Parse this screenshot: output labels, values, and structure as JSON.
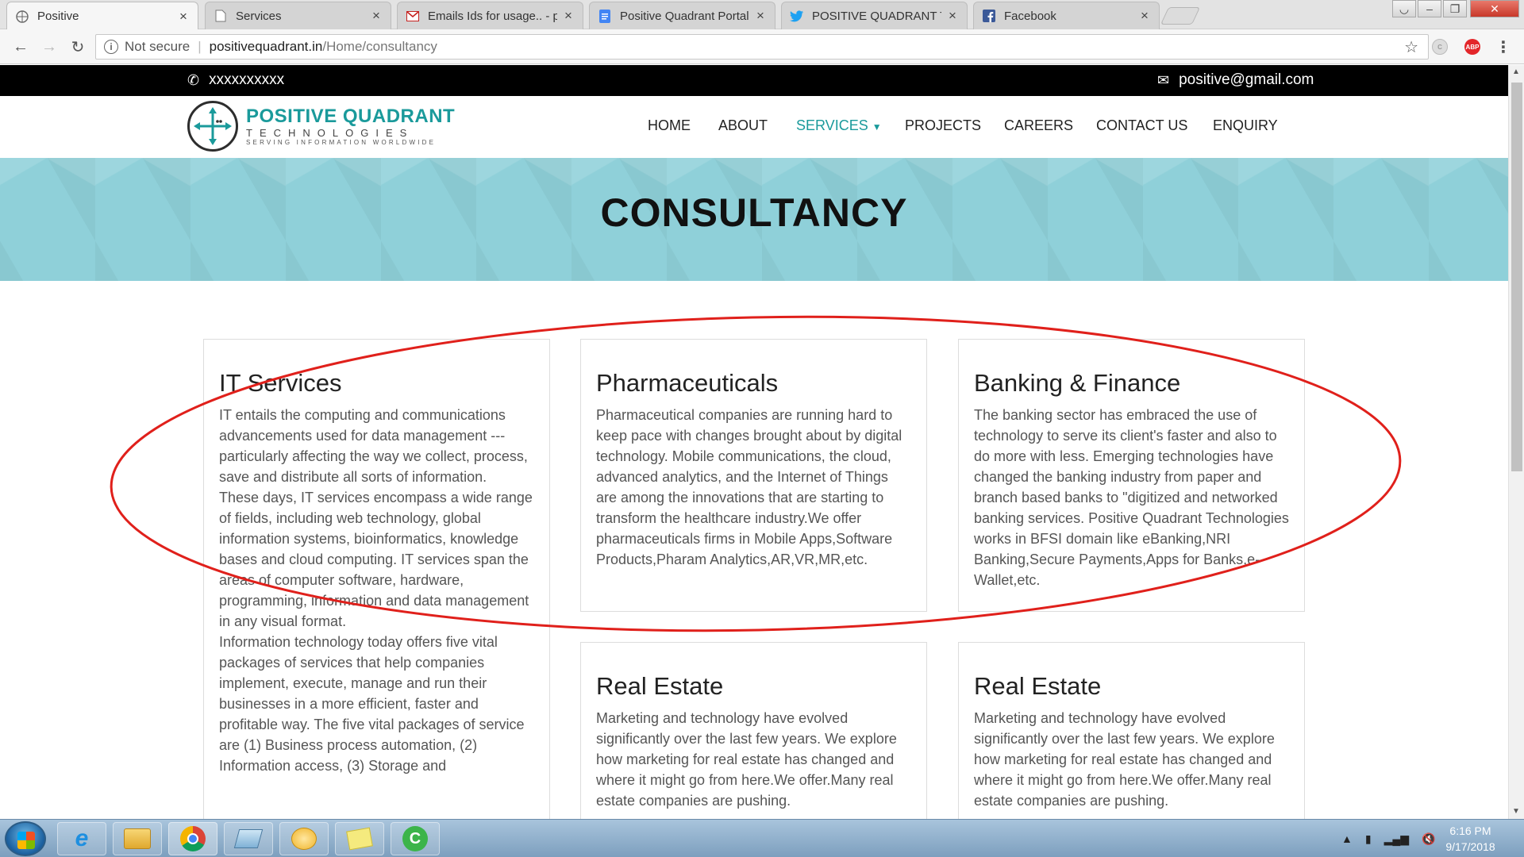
{
  "browser": {
    "tabs": [
      {
        "title": "Positive",
        "icon": "globe-icon",
        "active": true
      },
      {
        "title": "Services",
        "icon": "page-icon",
        "active": false
      },
      {
        "title": "Emails Ids for usage.. - pc",
        "icon": "gmail-icon",
        "active": false
      },
      {
        "title": "Positive Quadrant Portal",
        "icon": "docs-icon",
        "active": false
      },
      {
        "title": "POSITIVE QUADRANT TE",
        "icon": "twitter-icon",
        "active": false
      },
      {
        "title": "Facebook",
        "icon": "facebook-icon",
        "active": false
      }
    ],
    "security": "Not secure",
    "url_host": "positivequadrant.in",
    "url_path": "/Home/consultancy"
  },
  "site": {
    "phone": "xxxxxxxxxx",
    "email": "positive@gmail.com",
    "logo": {
      "brand": "POSITIVE QUADRANT",
      "sub": "TECHNOLOGIES",
      "tagline": "SERVING INFORMATION WORLDWIDE"
    },
    "nav": [
      "HOME",
      "ABOUT",
      "SERVICES",
      "PROJECTS",
      "CAREERS",
      "CONTACT US",
      "ENQUIRY"
    ],
    "active_nav": "SERVICES",
    "banner_title": "CONSULTANCY",
    "cards": [
      {
        "title": "IT Services",
        "body": "IT entails the computing and communications advancements used for data management --- particularly affecting the way we collect, process, save and distribute all sorts of information.\nThese days, IT services encompass a wide range of fields, including web technology, global information systems, bioinformatics, knowledge bases and cloud computing. IT services span the areas of computer software, hardware, programming, information and data management in any visual format.\nInformation technology today offers five vital packages of services that help companies implement, execute, manage and run their businesses in a more efficient, faster and profitable way. The five vital packages of service are (1) Business process automation, (2) Information access, (3) Storage and"
      },
      {
        "title": "Pharmaceuticals",
        "body": "Pharmaceutical companies are running hard to keep pace with changes brought about by digital technology. Mobile communications, the cloud, advanced analytics, and the Internet of Things are among the innovations that are starting to transform the healthcare industry.We offer pharmaceuticals firms in Mobile Apps,Software Products,Pharam Analytics,AR,VR,MR,etc."
      },
      {
        "title": "Banking & Finance",
        "body": "The banking sector has embraced the use of technology to serve its client's faster and also to do more with less. Emerging technologies have changed the banking industry from paper and branch based banks to \"digitized and networked banking services. Positive Quadrant Technologies works in BFSI domain like eBanking,NRI Banking,Secure Payments,Apps for Banks,e-Wallet,etc."
      },
      {
        "title": "Real Estate",
        "body": "Marketing and technology have evolved significantly over the last few years. We explore how marketing for real estate has changed and where it might go from here.We offer.Many real estate companies are pushing."
      },
      {
        "title": "Real Estate",
        "body": "Marketing and technology have evolved significantly over the last few years. We explore how marketing for real estate has changed and where it might go from here.We offer.Many real estate companies are pushing."
      }
    ]
  },
  "taskbar": {
    "apps": [
      "internet-explorer-icon",
      "file-explorer-icon",
      "chrome-icon",
      "notepad-icon",
      "outlook-icon",
      "sticky-notes-icon",
      "green-c-app-icon"
    ],
    "time": "6:16 PM",
    "date": "9/17/2018"
  },
  "colors": {
    "accent": "#1a9a9b",
    "banner": "#8fd0d9",
    "annotation": "#e0201b"
  }
}
